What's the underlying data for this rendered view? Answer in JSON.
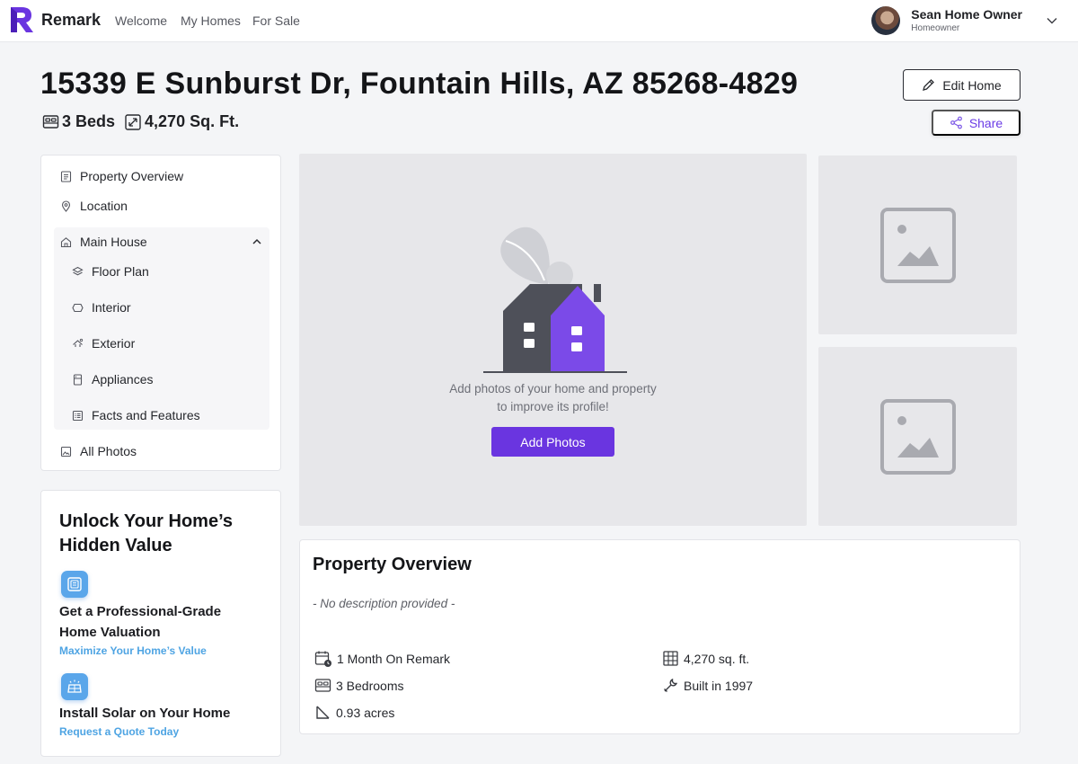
{
  "nav": {
    "brand": "Remark",
    "links": [
      "Welcome",
      "My Homes",
      "For Sale"
    ],
    "user": {
      "name": "Sean Home Owner",
      "role": "Homeowner"
    }
  },
  "home": {
    "address": "15339 E Sunburst Dr, Fountain Hills, AZ 85268-4829",
    "beds": "3 Beds",
    "sqft": "4,270 Sq. Ft.",
    "edit_label": "Edit Home",
    "share_label": "Share"
  },
  "sidebar": {
    "items": [
      {
        "label": "Property Overview",
        "icon": "document-icon"
      },
      {
        "label": "Location",
        "icon": "pin-icon"
      },
      {
        "label": "Main House",
        "icon": "house-icon"
      },
      {
        "label": "Floor Plan",
        "icon": "layers-icon"
      },
      {
        "label": "Interior",
        "icon": "interior-icon"
      },
      {
        "label": "Exterior",
        "icon": "exterior-icon"
      },
      {
        "label": "Appliances",
        "icon": "appliance-icon"
      },
      {
        "label": "Facts and Features",
        "icon": "list-icon"
      },
      {
        "label": "All Photos",
        "icon": "photo-icon"
      }
    ]
  },
  "promo": {
    "title": "Unlock Your Home’s Hidden Value",
    "valuation": {
      "heading": "Get a Professional-Grade Home Valuation",
      "link": "Maximize Your Home’s Value"
    },
    "solar": {
      "heading": "Install Solar on Your Home",
      "link": "Request a Quote Today"
    }
  },
  "photos": {
    "message_line1": "Add photos of your home and property",
    "message_line2": "to improve its profile!",
    "add_label": "Add Photos"
  },
  "overview": {
    "title": "Property Overview",
    "description": "- No description provided -",
    "facts": {
      "time_on_remark": "1 Month On Remark",
      "bedrooms": "3 Bedrooms",
      "acres": "0.93 acres",
      "sqft": "4,270 sq. ft.",
      "built": "Built in 1997"
    }
  },
  "colors": {
    "brand": "#6a35e0",
    "accent_link": "#4ea4e3",
    "photo_bg": "#e7e7ea"
  }
}
